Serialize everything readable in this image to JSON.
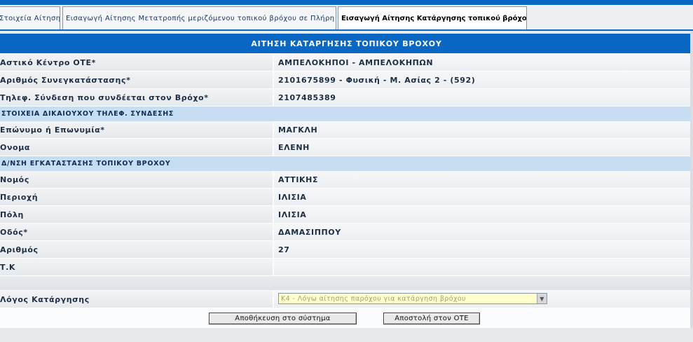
{
  "tabs": [
    {
      "label": "Στοιχεία Αίτησης"
    },
    {
      "label": "Εισαγωγή Αίτησης Μετατροπής μεριζόμενου τοπικού βρόχου σε Πλήρη"
    },
    {
      "label": "Εισαγωγή Αίτησης Κατάργησης τοπικού βρόχου"
    }
  ],
  "form": {
    "header": "ΑΙΤΗΣΗ ΚΑΤΑΡΓΗΣΗΣ ΤΟΠΙΚΟΥ ΒΡΟΧΟΥ",
    "fields": [
      {
        "label": "Αστικό Κέντρο ΟΤΕ*",
        "value": "ΑΜΠΕΛΟΚΗΠΟΙ - ΑΜΠΕΛΟΚΗΠΩΝ"
      },
      {
        "label": "Αριθμός Συνεγκατάστασης*",
        "value": "2101675899 - Φυσική - Μ. Ασίας 2 - (592)"
      },
      {
        "label": "Τηλεφ. Σύνδεση που συνδέεται στον Βρόχο*",
        "value": "2107485389"
      }
    ],
    "section_owner": "ΣΤΟΙΧΕΙΑ ΔΙΚΑΙΟΥΧΟΥ ΤΗΛΕΦ. ΣΥΝΔΕΣΗΣ",
    "owner_fields": [
      {
        "label": "Επώνυμο ή Επωνυμία*",
        "value": "ΜΑΓΚΛΗ"
      },
      {
        "label": "Ονομα",
        "value": "ΕΛΕΝΗ"
      }
    ],
    "section_address": "Δ/ΝΣΗ ΕΓΚΑΤΑΣΤΑΣΗΣ ΤΟΠΙΚΟΥ ΒΡΟΧΟΥ",
    "address_fields": [
      {
        "label": "Νομός",
        "value": "ΑΤΤΙΚΗΣ"
      },
      {
        "label": "Περιοχή",
        "value": "ΙΛΙΣΙΑ"
      },
      {
        "label": "Πόλη",
        "value": "ΙΛΙΣΙΑ"
      },
      {
        "label": "Οδός*",
        "value": "ΔΑΜΑΣΙΠΠΟΥ"
      },
      {
        "label": "Αριθμός",
        "value": "27"
      },
      {
        "label": "Τ.Κ",
        "value": ""
      }
    ],
    "reason": {
      "label": "Λόγος Κατάργησης",
      "selected": "Κ4 - Λόγω αίτησης παρόχου για κατάργηση βρόχου"
    }
  },
  "buttons": {
    "save": "Αποθήκευση στο σύστημα",
    "send": "Αποστολή στον ΟΤΕ"
  },
  "colors": {
    "accent": "#0a67c4",
    "section": "#c7ddf2",
    "select_bg": "#ffffcc"
  },
  "icons": {
    "select_arrow": "chevron-down-icon"
  }
}
